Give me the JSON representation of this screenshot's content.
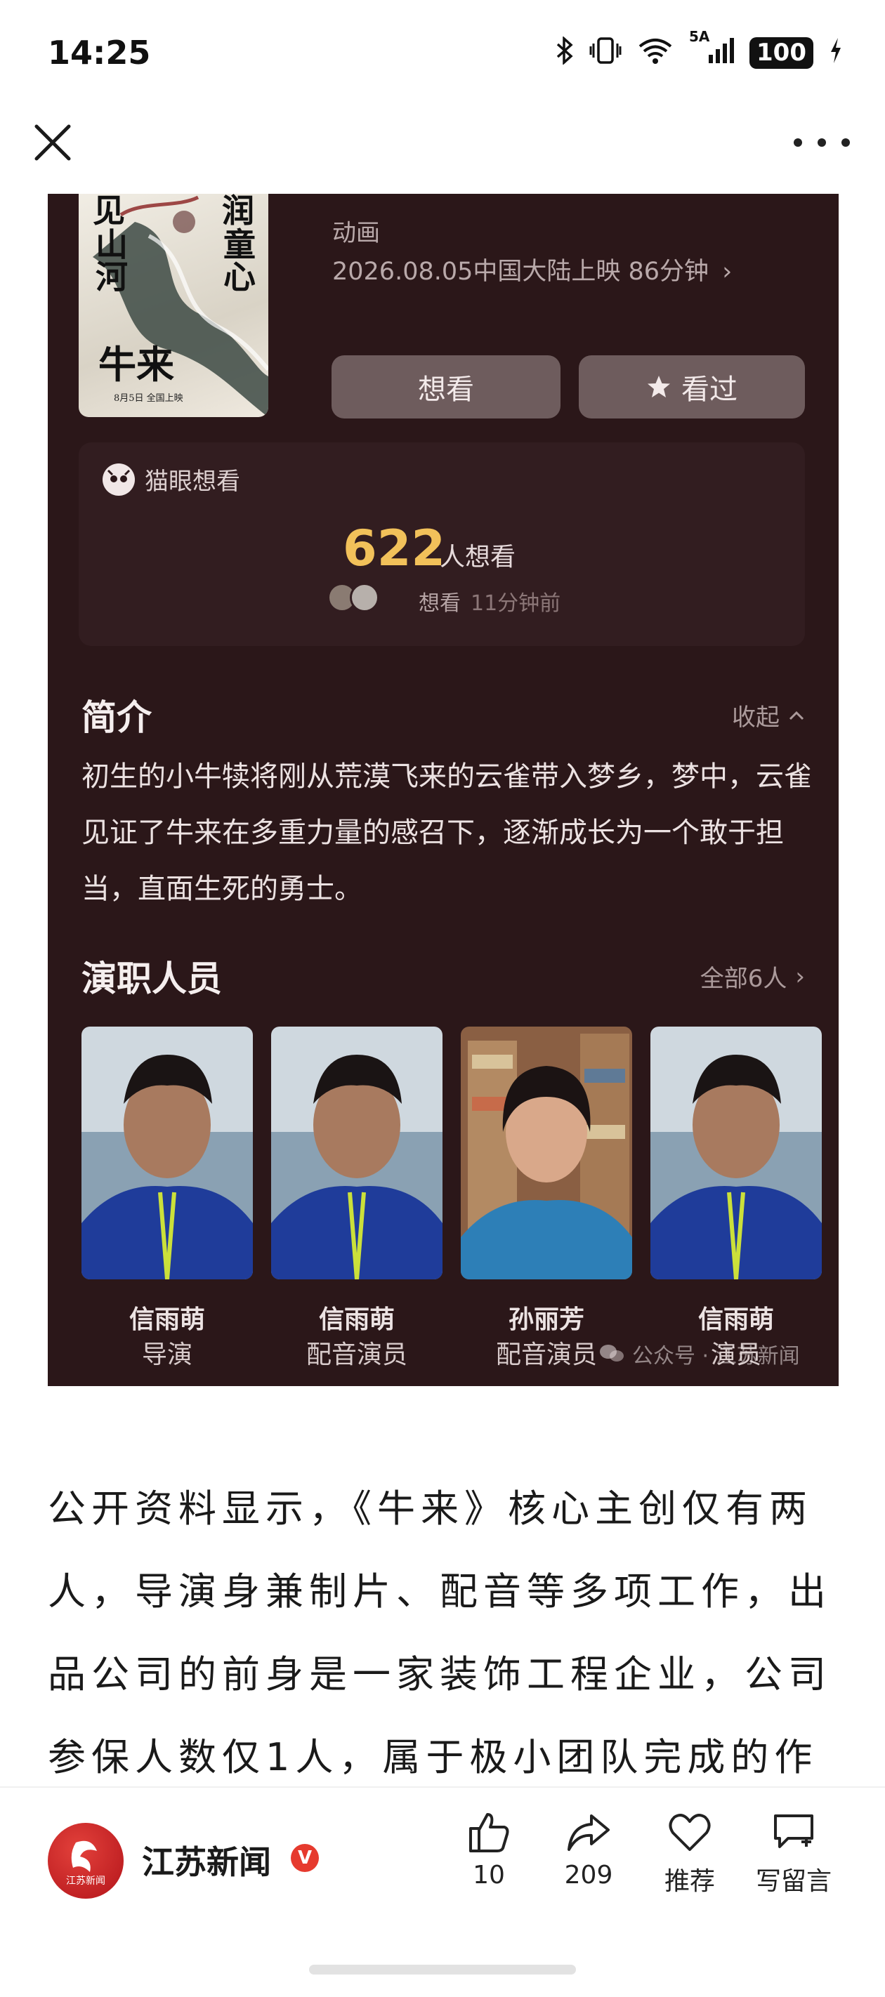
{
  "status_bar": {
    "time": "14:25",
    "network": "5A",
    "battery": "100"
  },
  "nav": {
    "close_icon": "close-icon",
    "more_icon": "more-icon"
  },
  "movie_card": {
    "poster": {
      "title": "牛来",
      "left_text_1": "见",
      "left_text_2": "山河",
      "right_text_1": "润",
      "right_text_2": "童心",
      "date_text": "8月5日 全国上映"
    },
    "genre": "动画",
    "release": "2026.08.05中国大陆上映 86分钟",
    "want_button": "想看",
    "seen_button": "看过",
    "maoyan": {
      "label": "猫眼想看",
      "count": "622",
      "count_unit": "人想看",
      "recent_action": "想看",
      "recent_time": "11分钟前"
    },
    "intro": {
      "title": "简介",
      "collapse": "收起",
      "text": "初生的小牛犊将刚从荒漠飞来的云雀带入梦乡，梦中，云雀见证了牛来在多重力量的感召下，逐渐成长为一个敢于担当，直面生死的勇士。"
    },
    "cast": {
      "title": "演职人员",
      "all": "全部6人",
      "members": [
        {
          "name": "信雨萌",
          "role": "导演"
        },
        {
          "name": "信雨萌",
          "role": "配音演员"
        },
        {
          "name": "孙丽芳",
          "role": "配音演员"
        },
        {
          "name": "信雨萌",
          "role": "演员"
        }
      ]
    },
    "watermark": "公众号 · 江苏新闻"
  },
  "article": {
    "paragraph": "公开资料显示，《牛来》核心主创仅有两人，导演身兼制片、配音等多项工作，出品公司的前身是一家装饰工程企业，公司参保人数仅1人，属于极小团队完成的作品。"
  },
  "bottom_bar": {
    "brand_name": "江苏新闻",
    "brand_logo_text": "江苏新闻",
    "verified": "V",
    "like_count": "10",
    "share_count": "209",
    "recommend_label": "推荐",
    "comment_label": "写留言"
  },
  "colors": {
    "card_bg": "#2b1719",
    "accent_count": "#f2c15a",
    "brand_red": "#e63a2e"
  }
}
